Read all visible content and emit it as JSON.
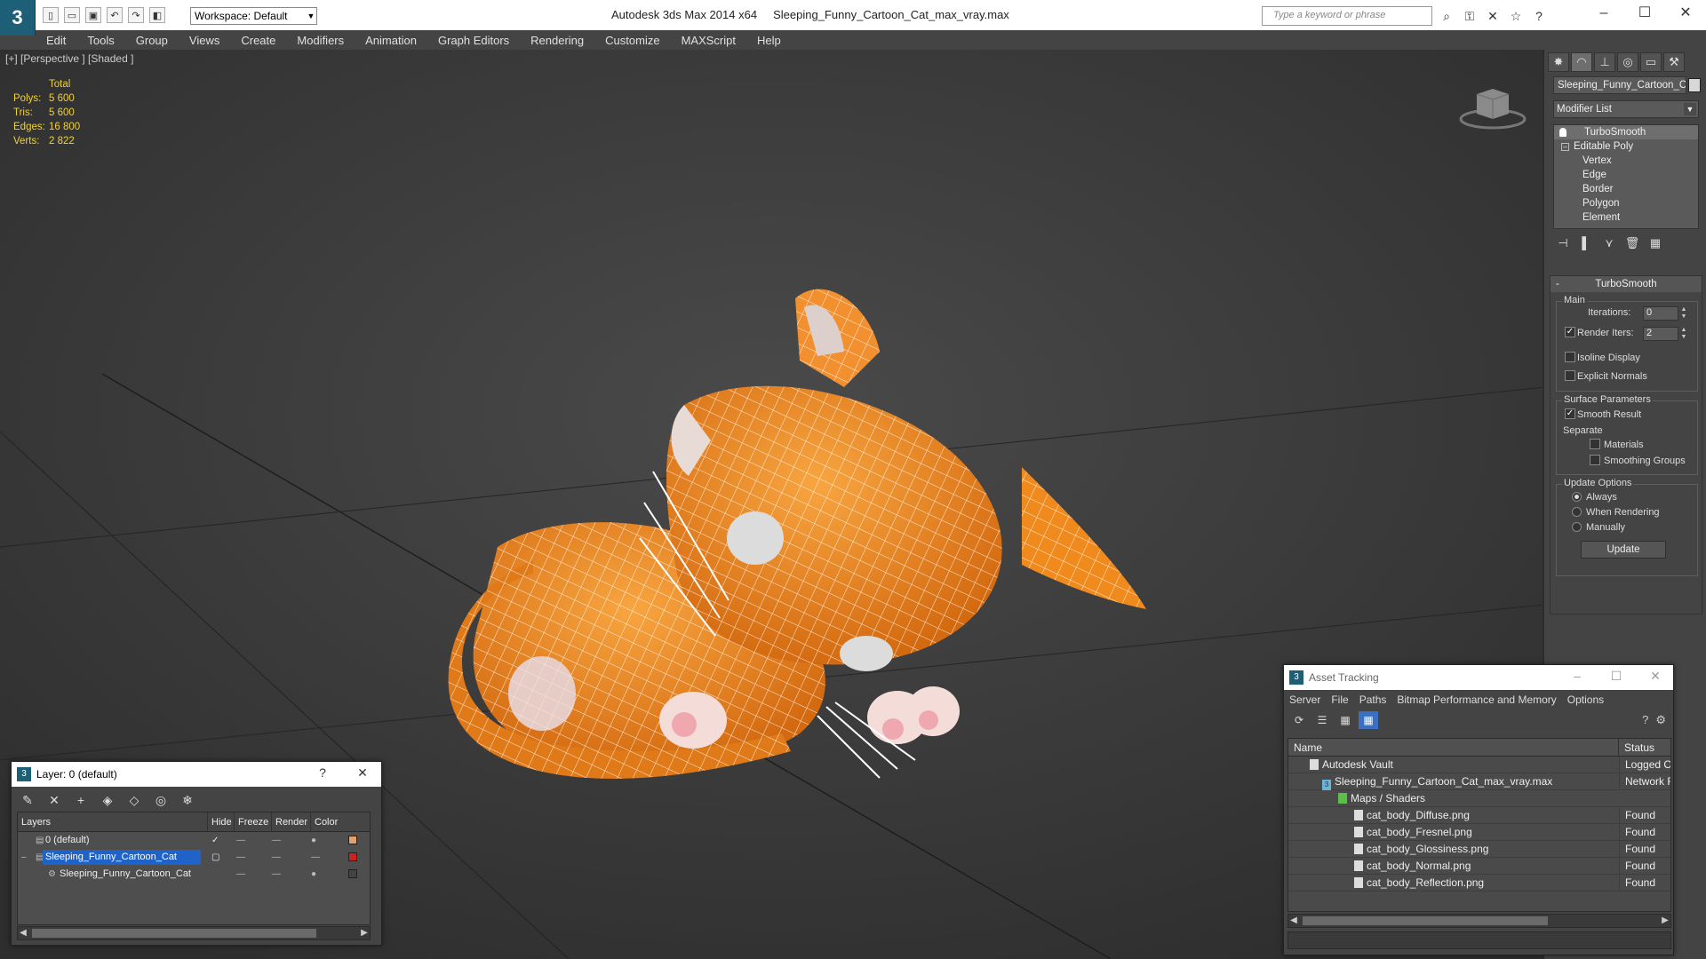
{
  "titlebar": {
    "app_logo": "3",
    "workspace": "Workspace: Default",
    "app_name": "Autodesk 3ds Max  2014 x64",
    "file_name": "Sleeping_Funny_Cartoon_Cat_max_vray.max",
    "search_placeholder": "Type a keyword or phrase"
  },
  "menu": [
    "Edit",
    "Tools",
    "Group",
    "Views",
    "Create",
    "Modifiers",
    "Animation",
    "Graph Editors",
    "Rendering",
    "Customize",
    "MAXScript",
    "Help"
  ],
  "viewport": {
    "label": "[+] [Perspective ] [Shaded ]",
    "stats_header": "Total",
    "stats": [
      {
        "k": "Polys:",
        "v": "5 600"
      },
      {
        "k": "Tris:",
        "v": "5 600"
      },
      {
        "k": "Edges:",
        "v": "16 800"
      },
      {
        "k": "Verts:",
        "v": "2 822"
      }
    ],
    "model_color": "#f08a1c",
    "wire_color": "#ffffff"
  },
  "command_panel": {
    "object_name": "Sleeping_Funny_Cartoon_Ca",
    "modifier_list": "Modifier List",
    "stack": [
      "TurboSmooth",
      "Editable Poly",
      "Vertex",
      "Edge",
      "Border",
      "Polygon",
      "Element"
    ],
    "rollout_title": "TurboSmooth",
    "main_label": "Main",
    "iterations_label": "Iterations:",
    "iterations_value": "0",
    "render_iters_label": "Render Iters:",
    "render_iters_value": "2",
    "isoline": "Isoline Display",
    "explicit_normals": "Explicit Normals",
    "surface_params": "Surface Parameters",
    "smooth_result": "Smooth Result",
    "separate": "Separate",
    "materials": "Materials",
    "smoothing_groups": "Smoothing Groups",
    "update_options": "Update Options",
    "always": "Always",
    "when_rendering": "When Rendering",
    "manually": "Manually",
    "update_button": "Update"
  },
  "layer_dialog": {
    "title": "Layer: 0 (default)",
    "help": "?",
    "columns": [
      "Layers",
      "Hide",
      "Freeze",
      "Render",
      "Color"
    ],
    "rows": [
      {
        "name": "0 (default)",
        "color": "#e8a06a"
      },
      {
        "name": "Sleeping_Funny_Cartoon_Cat",
        "color": "#cc2222"
      },
      {
        "name": "Sleeping_Funny_Cartoon_Cat",
        "color": "#444444"
      }
    ]
  },
  "asset_tracking": {
    "title": "Asset Tracking",
    "menu": [
      "Server",
      "File",
      "Paths",
      "Bitmap Performance and Memory",
      "Options"
    ],
    "columns": [
      "Name",
      "Status"
    ],
    "rows": [
      {
        "name": "Autodesk Vault",
        "status": "Logged O"
      },
      {
        "name": "Sleeping_Funny_Cartoon_Cat_max_vray.max",
        "status": "Network F"
      },
      {
        "name": "Maps / Shaders",
        "status": ""
      },
      {
        "name": "cat_body_Diffuse.png",
        "status": "Found"
      },
      {
        "name": "cat_body_Fresnel.png",
        "status": "Found"
      },
      {
        "name": "cat_body_Glossiness.png",
        "status": "Found"
      },
      {
        "name": "cat_body_Normal.png",
        "status": "Found"
      },
      {
        "name": "cat_body_Reflection.png",
        "status": "Found"
      }
    ]
  }
}
